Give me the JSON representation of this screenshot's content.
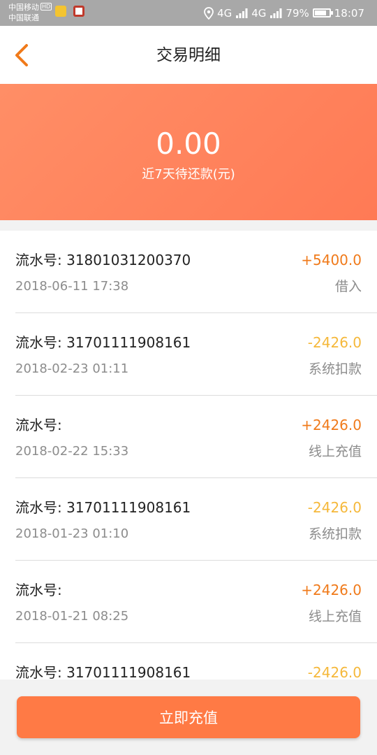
{
  "status_bar": {
    "carrier_1": "中国移动",
    "hd_badge": "HD",
    "carrier_2": "中国联通",
    "network_1": "4G",
    "network_2": "4G",
    "battery_percent": "79%",
    "battery_level": 0.79,
    "time": "18:07"
  },
  "header": {
    "title": "交易明细"
  },
  "hero": {
    "amount": "0.00",
    "label": "近7天待还款(元)"
  },
  "colors": {
    "accent": "#ff7a45",
    "amount_positive": "#f07a1a",
    "amount_negative": "#f5b83a",
    "text_primary": "#222222",
    "text_secondary": "#8c8c8c"
  },
  "transactions": [
    {
      "serial": "流水号: 31801031200370",
      "date": "2018-06-11 17:38",
      "amount": "+5400.0",
      "type": "借入",
      "sign": "positive"
    },
    {
      "serial": "流水号: 31701111908161",
      "date": "2018-02-23 01:11",
      "amount": "-2426.0",
      "type": "系统扣款",
      "sign": "negative"
    },
    {
      "serial": "流水号:",
      "date": "2018-02-22 15:33",
      "amount": "+2426.0",
      "type": "线上充值",
      "sign": "positive"
    },
    {
      "serial": "流水号: 31701111908161",
      "date": "2018-01-23 01:10",
      "amount": "-2426.0",
      "type": "系统扣款",
      "sign": "negative"
    },
    {
      "serial": "流水号:",
      "date": "2018-01-21 08:25",
      "amount": "+2426.0",
      "type": "线上充值",
      "sign": "positive"
    },
    {
      "serial": "流水号: 31701111908161",
      "date": "",
      "amount": "-2426.0",
      "type": "",
      "sign": "negative"
    }
  ],
  "footer": {
    "button_label": "立即充值"
  }
}
